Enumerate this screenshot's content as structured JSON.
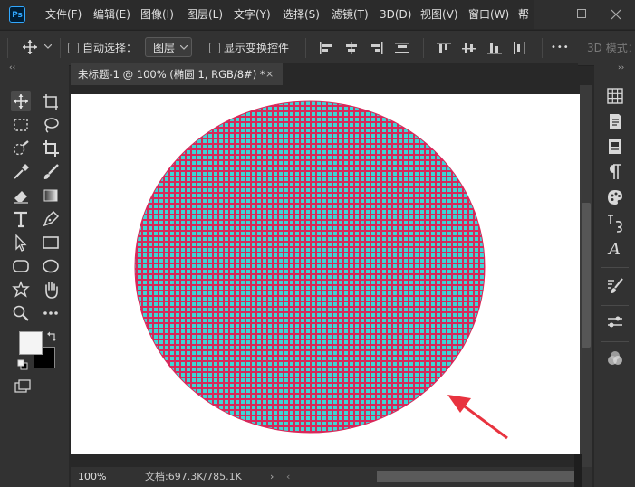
{
  "app": {
    "logo_text": "Ps"
  },
  "menu": {
    "items": [
      "文件(F)",
      "编辑(E)",
      "图像(I)",
      "图层(L)",
      "文字(Y)",
      "选择(S)",
      "滤镜(T)",
      "3D(D)",
      "视图(V)",
      "窗口(W)",
      "帮"
    ]
  },
  "options_bar": {
    "auto_select_label": "自动选择：",
    "layer_select_value": "图层",
    "show_transform_label": "显示变换控件",
    "more_label": "•••",
    "mode_3d_label": "3D 模式："
  },
  "panels": {
    "collapse_glyph": "‹‹",
    "collapse_right_glyph": "››"
  },
  "document": {
    "tab_title": "未标题-1 @ 100% (椭圆 1, RGB/8#) *",
    "close_glyph": "×"
  },
  "status": {
    "zoom": "100%",
    "doc_info": "文档:697.3K/785.1K",
    "chevron": "›",
    "left_arrow": "‹"
  },
  "colors": {
    "foreground": "#f4f4f4",
    "background": "#000000",
    "pattern_red": "#d8285a",
    "pattern_cyan": "#3ed6d6",
    "arrow_red": "#e8333f"
  },
  "icons": {
    "tools": [
      "move-icon",
      "artboard-icon",
      "marquee-icon",
      "lasso-icon",
      "quick-select-icon",
      "crop-icon",
      "eyedropper-icon",
      "brush-icon",
      "eraser-icon",
      "gradient-icon",
      "type-icon",
      "pen-icon",
      "path-select-icon",
      "rectangle-icon",
      "rounded-rect-icon",
      "ellipse-icon",
      "custom-shape-icon",
      "hand-icon",
      "zoom-icon",
      "more-tools-icon"
    ],
    "dock": [
      "swatches-icon",
      "properties-icon",
      "libraries-icon",
      "paragraph-icon",
      "color-palette-icon",
      "character-icon",
      "glyphs-icon",
      "brush-settings-icon",
      "adjustments-icon",
      "channels-icon"
    ]
  }
}
